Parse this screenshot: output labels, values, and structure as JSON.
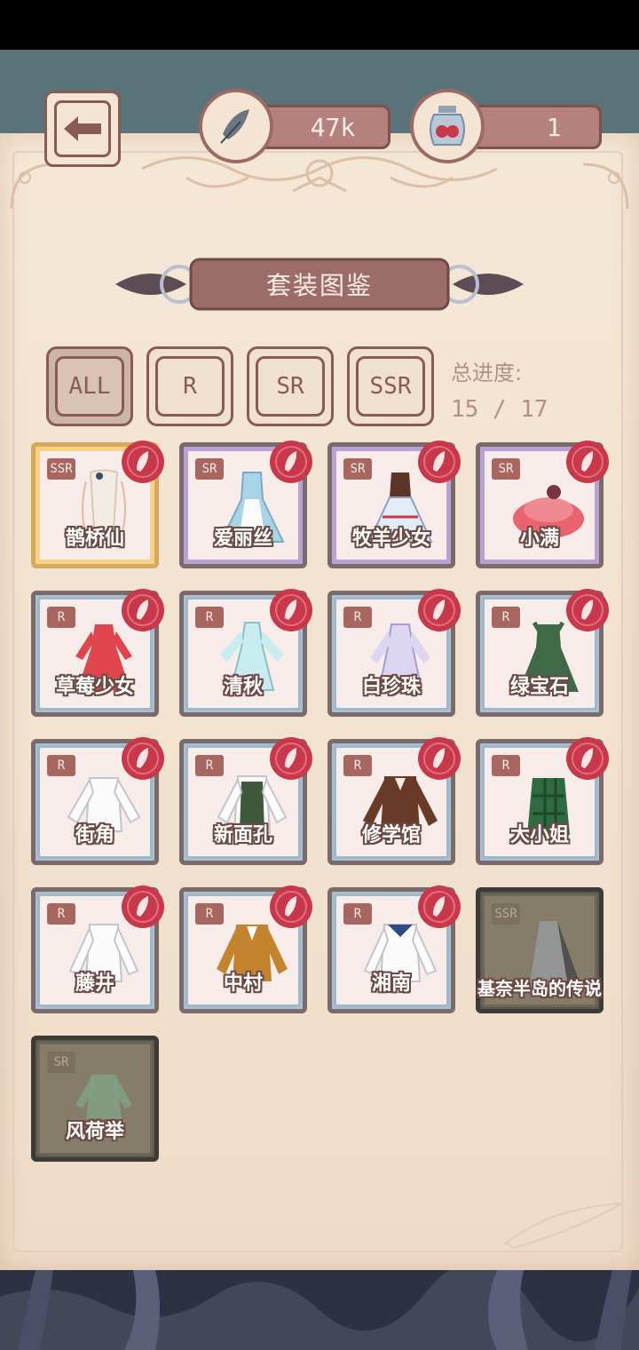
{
  "header": {
    "feather_count": "47k",
    "jar_count": "1"
  },
  "title": "套装图鉴",
  "filters": [
    {
      "label": "ALL",
      "active": true
    },
    {
      "label": "R",
      "active": false
    },
    {
      "label": "SR",
      "active": false
    },
    {
      "label": "SSR",
      "active": false
    }
  ],
  "progress": {
    "label": "总进度:",
    "value": "15 / 17"
  },
  "outfits": [
    {
      "name": "鹊桥仙",
      "rarity": "SSR",
      "collected": true
    },
    {
      "name": "爱丽丝",
      "rarity": "SR",
      "collected": true
    },
    {
      "name": "牧羊少女",
      "rarity": "SR",
      "collected": true
    },
    {
      "name": "小满",
      "rarity": "SR",
      "collected": true
    },
    {
      "name": "草莓少女",
      "rarity": "R",
      "collected": true
    },
    {
      "name": "清秋",
      "rarity": "R",
      "collected": true
    },
    {
      "name": "白珍珠",
      "rarity": "R",
      "collected": true
    },
    {
      "name": "绿宝石",
      "rarity": "R",
      "collected": true
    },
    {
      "name": "街角",
      "rarity": "R",
      "collected": true
    },
    {
      "name": "新面孔",
      "rarity": "R",
      "collected": true
    },
    {
      "name": "修学馆",
      "rarity": "R",
      "collected": true
    },
    {
      "name": "大小姐",
      "rarity": "R",
      "collected": true
    },
    {
      "name": "藤井",
      "rarity": "R",
      "collected": true
    },
    {
      "name": "中村",
      "rarity": "R",
      "collected": true
    },
    {
      "name": "湘南",
      "rarity": "R",
      "collected": true
    },
    {
      "name": "基奈半岛的传说",
      "rarity": "SSR",
      "collected": false
    },
    {
      "name": "风荷举",
      "rarity": "SR",
      "collected": false
    }
  ],
  "icons": {
    "back": "back-arrow-icon",
    "feather": "feather-icon",
    "jar": "berry-jar-icon",
    "seal": "wax-seal-feather-icon"
  },
  "colors": {
    "accent": "#b5817c",
    "r_frame": "#a8c0d0",
    "sr_frame": "#b8a3cf",
    "ssr_frame": "#f7d38a",
    "seal": "#c8384a"
  }
}
